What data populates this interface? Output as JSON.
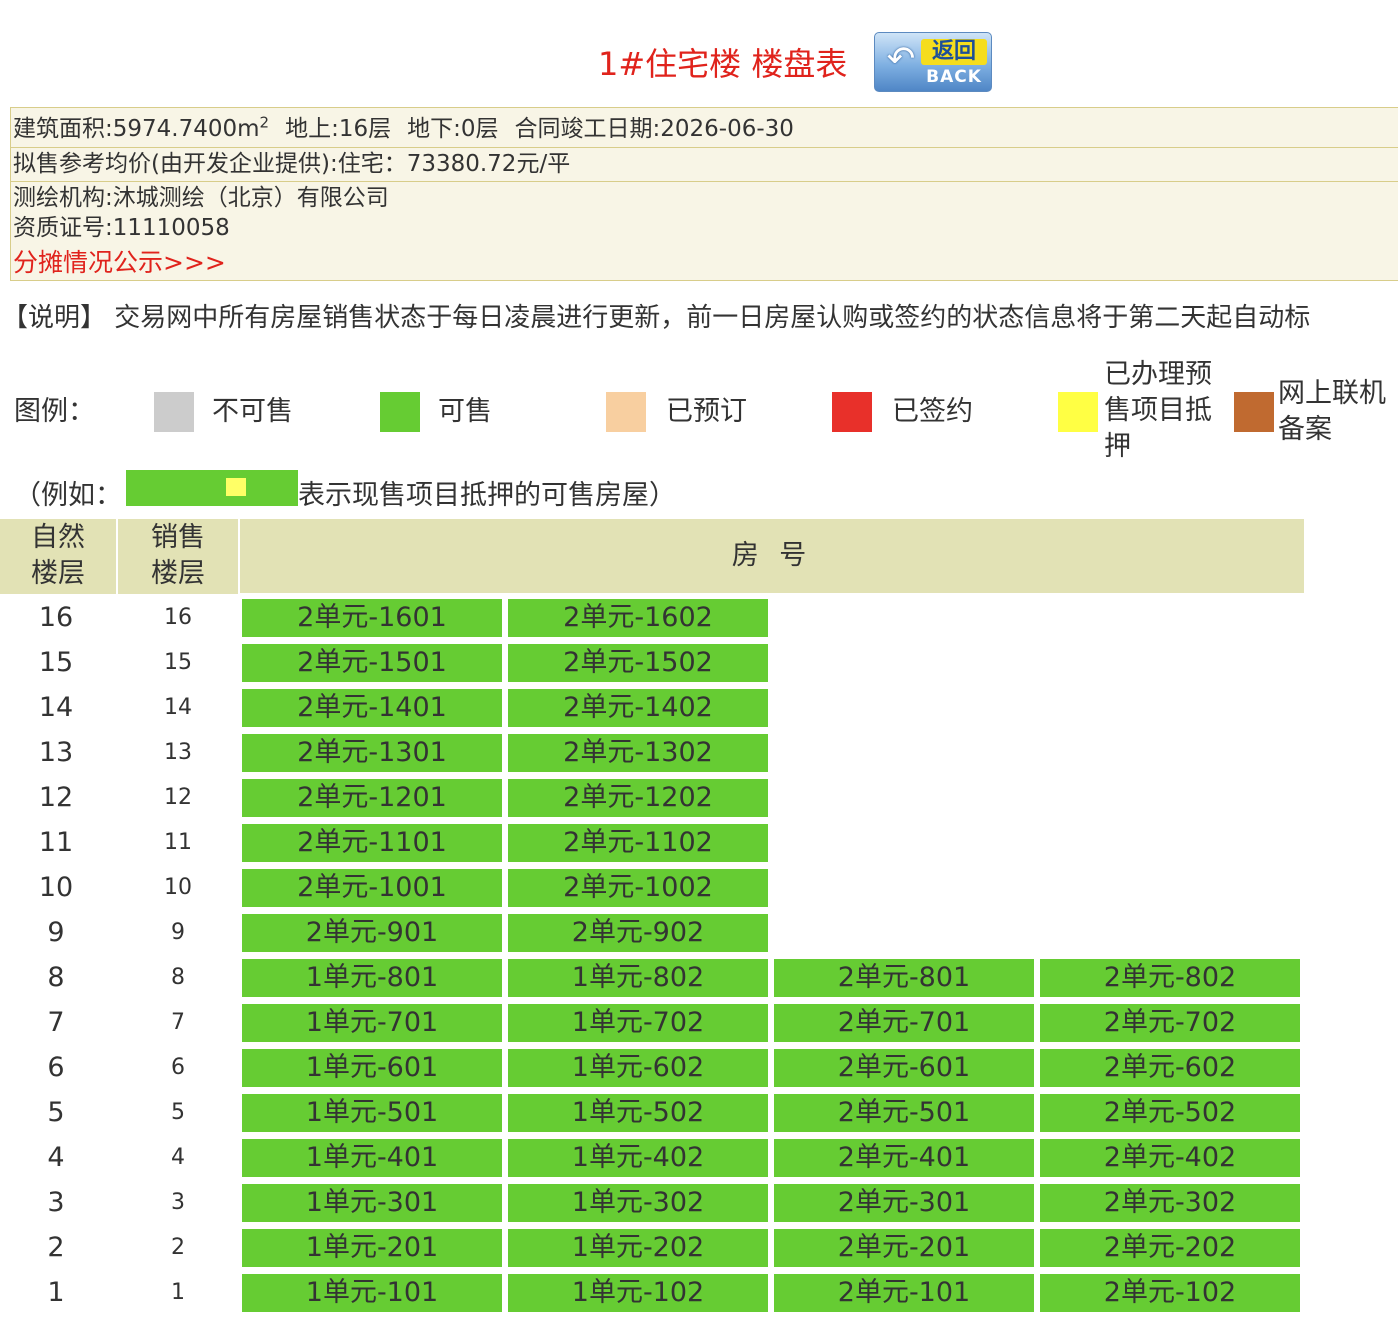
{
  "header": {
    "title": "1#住宅楼 楼盘表",
    "back_cn": "返回",
    "back_en": "BACK"
  },
  "info": {
    "area_label": "建筑面积:5974.7400m",
    "area_sup": "2",
    "above": "地上:16层",
    "below": "地下:0层",
    "completion": "合同竣工日期:2026-06-30",
    "price": "拟售参考均价(由开发企业提供):住宅：73380.72元/平",
    "surveyor": "测绘机构:沐城测绘（北京）有限公司",
    "cert": "资质证号:11110058",
    "share_link": "分摊情况公示>>>"
  },
  "notice": "【说明】 交易网中所有房屋销售状态于每日凌晨进行更新，前一日房屋认购或签约的状态信息将于第二天起自动标",
  "legend": {
    "label": "图例：",
    "items": [
      {
        "label": "不可售",
        "color": "#cccccc"
      },
      {
        "label": "可售",
        "color": "#66cc33"
      },
      {
        "label": "已预订",
        "color": "#f8cfa0"
      },
      {
        "label": "已签约",
        "color": "#e8302a"
      },
      {
        "label": "已办理预售项目抵押",
        "line1": "已办理预",
        "line2": "售项目抵",
        "line3": "押",
        "color": "#ffff44"
      },
      {
        "label": "网上联机备案",
        "line1": "网上联机",
        "line2": "备案",
        "color": "#c06a30"
      }
    ]
  },
  "example": {
    "prefix": "（例如：",
    "suffix": "表示现售项目抵押的可售房屋）"
  },
  "table": {
    "col_natural_1": "自然",
    "col_natural_2": "楼层",
    "col_sale_1": "销售",
    "col_sale_2": "楼层",
    "col_room": "房 号",
    "rows": [
      {
        "floor": "16",
        "sale": "16",
        "rooms": [
          "2单元-1601",
          "2单元-1602"
        ]
      },
      {
        "floor": "15",
        "sale": "15",
        "rooms": [
          "2单元-1501",
          "2单元-1502"
        ]
      },
      {
        "floor": "14",
        "sale": "14",
        "rooms": [
          "2单元-1401",
          "2单元-1402"
        ]
      },
      {
        "floor": "13",
        "sale": "13",
        "rooms": [
          "2单元-1301",
          "2单元-1302"
        ]
      },
      {
        "floor": "12",
        "sale": "12",
        "rooms": [
          "2单元-1201",
          "2单元-1202"
        ]
      },
      {
        "floor": "11",
        "sale": "11",
        "rooms": [
          "2单元-1101",
          "2单元-1102"
        ]
      },
      {
        "floor": "10",
        "sale": "10",
        "rooms": [
          "2单元-1001",
          "2单元-1002"
        ]
      },
      {
        "floor": "9",
        "sale": "9",
        "rooms": [
          "2单元-901",
          "2单元-902"
        ]
      },
      {
        "floor": "8",
        "sale": "8",
        "rooms": [
          "1单元-801",
          "1单元-802",
          "2单元-801",
          "2单元-802"
        ]
      },
      {
        "floor": "7",
        "sale": "7",
        "rooms": [
          "1单元-701",
          "1单元-702",
          "2单元-701",
          "2单元-702"
        ]
      },
      {
        "floor": "6",
        "sale": "6",
        "rooms": [
          "1单元-601",
          "1单元-602",
          "2单元-601",
          "2单元-602"
        ]
      },
      {
        "floor": "5",
        "sale": "5",
        "rooms": [
          "1单元-501",
          "1单元-502",
          "2单元-501",
          "2单元-502"
        ]
      },
      {
        "floor": "4",
        "sale": "4",
        "rooms": [
          "1单元-401",
          "1单元-402",
          "2单元-401",
          "2单元-402"
        ]
      },
      {
        "floor": "3",
        "sale": "3",
        "rooms": [
          "1单元-301",
          "1单元-302",
          "2单元-301",
          "2单元-302"
        ]
      },
      {
        "floor": "2",
        "sale": "2",
        "rooms": [
          "1单元-201",
          "1单元-202",
          "2单元-201",
          "2单元-202"
        ]
      },
      {
        "floor": "1",
        "sale": "1",
        "rooms": [
          "1单元-101",
          "1单元-102",
          "2单元-101",
          "2单元-102"
        ]
      }
    ]
  }
}
